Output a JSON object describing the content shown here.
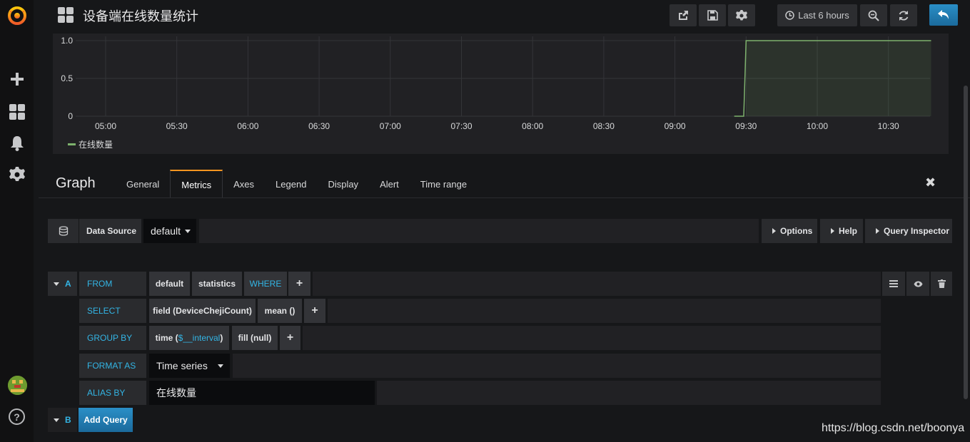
{
  "dashboard": {
    "title": "设备端在线数量统计"
  },
  "toolbar": {
    "time_range": "Last 6 hours"
  },
  "chart_data": {
    "type": "line",
    "x": [
      "05:00",
      "05:30",
      "06:00",
      "06:30",
      "07:00",
      "07:30",
      "08:00",
      "08:30",
      "09:00",
      "09:30",
      "10:00",
      "10:30"
    ],
    "yticks": [
      "1.0",
      "0.5",
      "0"
    ],
    "ylim": [
      0,
      1
    ],
    "series": [
      {
        "name": "在线数量",
        "color": "#7eb26d",
        "points": [
          [
            "09:25",
            0
          ],
          [
            "09:29",
            0
          ],
          [
            "09:30",
            1
          ],
          [
            "10:48",
            1
          ]
        ]
      }
    ],
    "grid": true,
    "legend": "bottom-left"
  },
  "editor": {
    "title": "Graph",
    "tabs": [
      "General",
      "Metrics",
      "Axes",
      "Legend",
      "Display",
      "Alert",
      "Time range"
    ],
    "active_tab": "Metrics"
  },
  "datasource": {
    "label": "Data Source",
    "value": "default",
    "options_btn": "Options",
    "help_btn": "Help",
    "inspector_btn": "Query Inspector"
  },
  "query_a": {
    "letter": "A",
    "from_label": "FROM",
    "from_db": "default",
    "from_measure": "statistics",
    "where_label": "WHERE",
    "select_label": "SELECT",
    "select_field": "field (DeviceChejiCount)",
    "select_fn": "mean ()",
    "groupby_label": "GROUP BY",
    "groupby_time_prefix": "time (",
    "groupby_time_var": "$__interval",
    "groupby_time_suffix": ")",
    "groupby_fill": "fill (null)",
    "format_label": "FORMAT AS",
    "format_value": "Time series",
    "alias_label": "ALIAS BY",
    "alias_value": "在线数量"
  },
  "query_b": {
    "letter": "B",
    "add_label": "Add Query"
  },
  "watermark": "https://blog.csdn.net/boonya"
}
